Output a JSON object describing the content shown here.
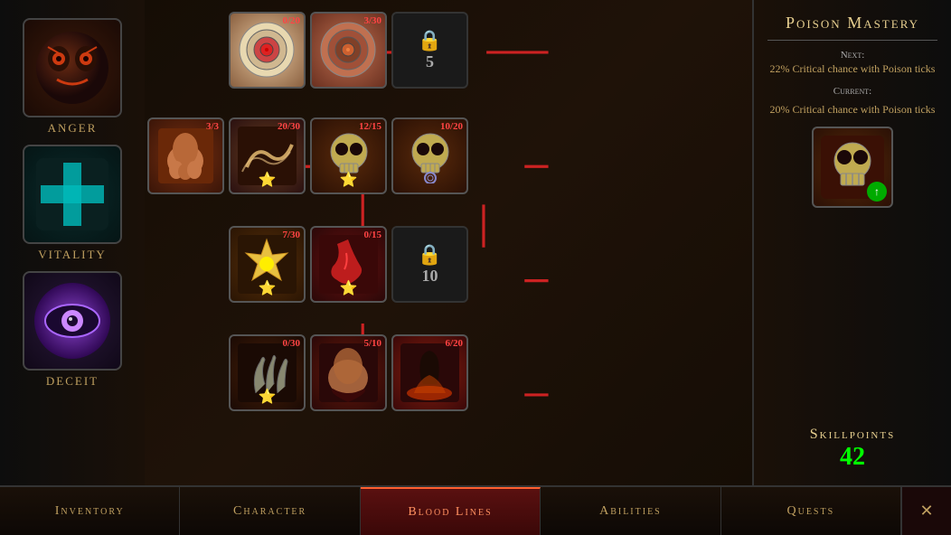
{
  "app": {
    "title": "Blood Lines"
  },
  "sidebar": {
    "items": [
      {
        "id": "anger",
        "label": "Anger"
      },
      {
        "id": "vitality",
        "label": "Vitality"
      },
      {
        "id": "deceit",
        "label": "Deceit"
      }
    ]
  },
  "right_panel": {
    "title": "Poison Mastery",
    "next_label": "Next:",
    "next_desc": "22% Critical chance with Poison ticks",
    "current_label": "Current:",
    "current_desc": "20% Critical chance with Poison ticks",
    "skillpoints_label": "Skillpoints",
    "skillpoints_value": "42"
  },
  "skill_nodes": [
    {
      "id": "target1",
      "counter": "0/20",
      "locked": false,
      "star": false,
      "col": 1,
      "row": 0
    },
    {
      "id": "target2",
      "counter": "3/30",
      "locked": false,
      "star": false,
      "col": 2,
      "row": 0
    },
    {
      "id": "locked1",
      "counter": "",
      "locked": true,
      "lock_num": "5",
      "star": false,
      "col": 3,
      "row": 0
    },
    {
      "id": "arm",
      "counter": "3/3",
      "locked": false,
      "star": false,
      "col": 0,
      "row": 1
    },
    {
      "id": "wind",
      "counter": "20/30",
      "locked": false,
      "star": true,
      "col": 1,
      "row": 1
    },
    {
      "id": "skull1",
      "counter": "12/15",
      "locked": false,
      "star": true,
      "col": 2,
      "row": 1
    },
    {
      "id": "skull2",
      "counter": "10/20",
      "locked": false,
      "star": false,
      "col": 3,
      "row": 1
    },
    {
      "id": "explosion",
      "counter": "7/30",
      "locked": false,
      "star": true,
      "col": 1,
      "row": 2
    },
    {
      "id": "blood",
      "counter": "0/15",
      "locked": false,
      "star": true,
      "col": 2,
      "row": 2
    },
    {
      "id": "locked2",
      "counter": "",
      "locked": true,
      "lock_num": "10",
      "star": false,
      "col": 3,
      "row": 2
    },
    {
      "id": "claw",
      "counter": "0/30",
      "locked": false,
      "star": true,
      "col": 1,
      "row": 3
    },
    {
      "id": "dark_arm",
      "counter": "5/10",
      "locked": false,
      "star": false,
      "col": 2,
      "row": 3
    },
    {
      "id": "lava",
      "counter": "6/20",
      "locked": false,
      "star": false,
      "col": 3,
      "row": 3
    }
  ],
  "nav": {
    "items": [
      {
        "id": "inventory",
        "label": "Inventory",
        "active": false
      },
      {
        "id": "character",
        "label": "Character",
        "active": false
      },
      {
        "id": "blood_lines",
        "label": "Blood Lines",
        "active": true
      },
      {
        "id": "abilities",
        "label": "Abilities",
        "active": false
      },
      {
        "id": "quests",
        "label": "Quests",
        "active": false
      }
    ],
    "close_label": "✕"
  }
}
